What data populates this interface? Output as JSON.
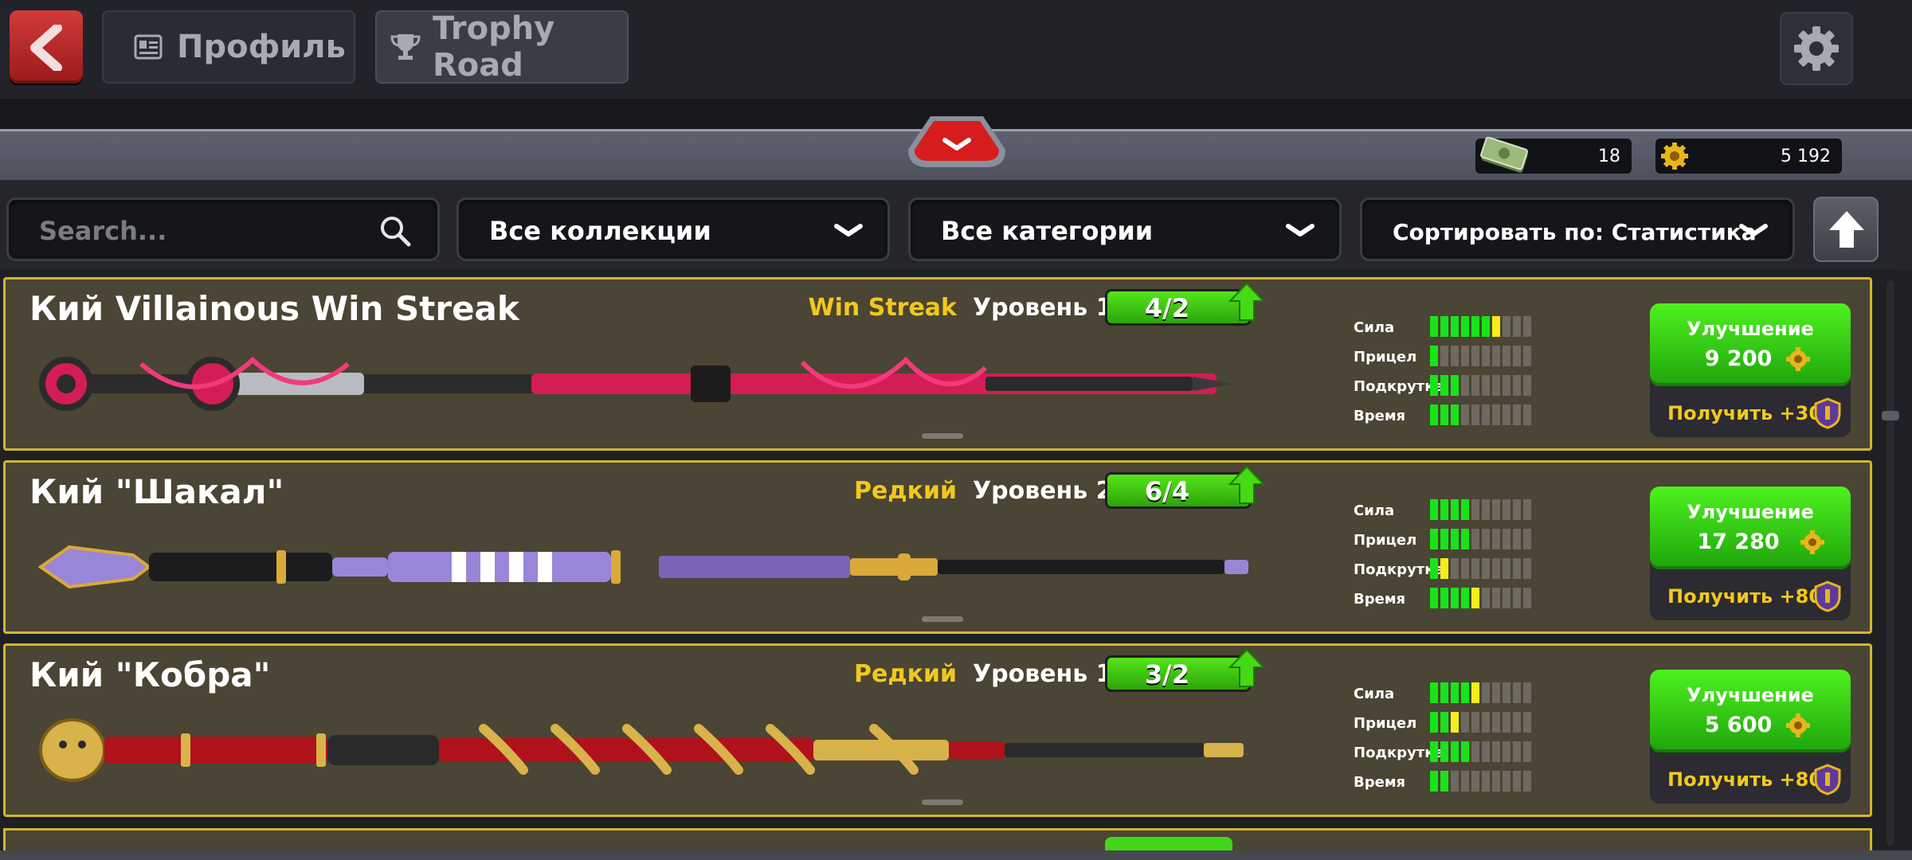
{
  "topbar": {
    "back_icon": "back-arrow-icon",
    "tabs": [
      {
        "label": "Профиль",
        "icon": "profile-card-icon"
      },
      {
        "label": "Trophy Road",
        "icon": "trophy-icon"
      }
    ],
    "settings_icon": "gear-icon"
  },
  "currency": {
    "cash": "18",
    "coins": "5 192"
  },
  "filters": {
    "search_placeholder": "Search...",
    "collections": "Все коллекции",
    "categories": "Все категории",
    "sort": "Сортировать по: Статистика"
  },
  "stat_labels": [
    "Сила",
    "Прицел",
    "Подкрутка",
    "Время"
  ],
  "cues": [
    {
      "name": "Кий Villainous Win Streak",
      "rarity": "Win Streak",
      "level": "Уровень 1",
      "progress": "4/2",
      "stats": [
        {
          "filled": 6,
          "yellow": 1,
          "total": 10
        },
        {
          "filled": 1,
          "yellow": 0,
          "total": 10
        },
        {
          "filled": 3,
          "yellow": 0,
          "total": 10
        },
        {
          "filled": 3,
          "yellow": 0,
          "total": 10
        }
      ],
      "upgrade_label": "Улучшение",
      "upgrade_cost": "9 200",
      "get_label": "Получить +30",
      "colors": {
        "primary": "#d21e54",
        "secondary": "#2b2b2b",
        "accent": "#f23a7a"
      }
    },
    {
      "name": "Кий \"Шакал\"",
      "rarity": "Редкий",
      "level": "Уровень 2",
      "progress": "6/4",
      "stats": [
        {
          "filled": 4,
          "yellow": 0,
          "total": 10
        },
        {
          "filled": 4,
          "yellow": 0,
          "total": 10
        },
        {
          "filled": 1,
          "yellow": 1,
          "total": 10
        },
        {
          "filled": 4,
          "yellow": 1,
          "total": 10
        }
      ],
      "upgrade_label": "Улучшение",
      "upgrade_cost": "17 280",
      "get_label": "Получить +80",
      "colors": {
        "primary": "#9a86d8",
        "secondary": "#1c1c1c",
        "accent": "#d9a93a"
      }
    },
    {
      "name": "Кий \"Кобра\"",
      "rarity": "Редкий",
      "level": "Уровень 1",
      "progress": "3/2",
      "stats": [
        {
          "filled": 4,
          "yellow": 1,
          "total": 10
        },
        {
          "filled": 2,
          "yellow": 1,
          "total": 10
        },
        {
          "filled": 4,
          "yellow": 0,
          "total": 10
        },
        {
          "filled": 2,
          "yellow": 0,
          "total": 10
        }
      ],
      "upgrade_label": "Улучшение",
      "upgrade_cost": "5 600",
      "get_label": "Получить +80",
      "colors": {
        "primary": "#b0121c",
        "secondary": "#2a2a2a",
        "accent": "#d8b24a"
      }
    }
  ],
  "palette": {
    "card_bg": "#4a4534",
    "card_border": "#d3b62c",
    "rarity_yellow": "#f2c81d",
    "green": "#2ca40a",
    "stat_green": "#18e41a",
    "stat_yellow": "#f5ee1a"
  }
}
